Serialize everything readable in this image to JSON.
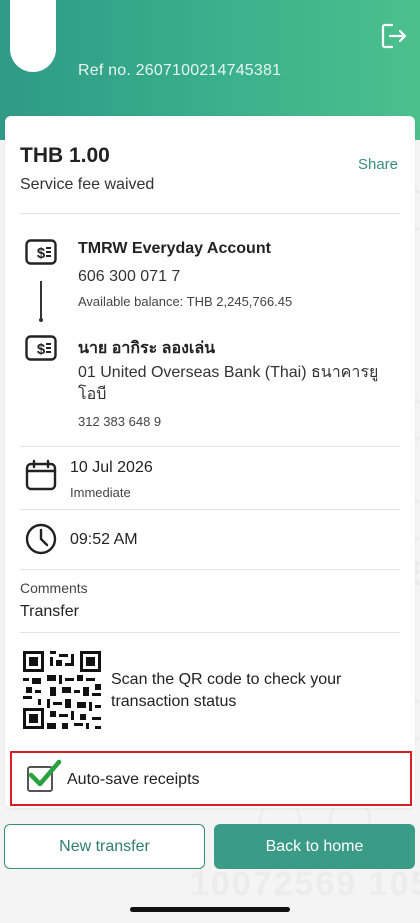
{
  "header": {
    "ref_label": "Ref no. 2607100214745381",
    "accent_color": "#37ad8c"
  },
  "watermark": {
    "text": "10072569 105"
  },
  "transfer": {
    "amount": "THB 1.00",
    "fee_note": "Service fee waived",
    "share_label": "Share"
  },
  "from_account": {
    "name": "TMRW Everyday Account",
    "number": "606 300 071 7",
    "balance": "Available balance: THB 2,245,766.45",
    "icon": "wallet-icon"
  },
  "to_account": {
    "name": "นาย อากิระ ลองเล่น",
    "bank": "01 United Overseas Bank (Thai) ธนาคารยูโอบี",
    "number": "312 383 648 9",
    "icon": "wallet-icon"
  },
  "schedule": {
    "date": "10 Jul 2026",
    "timing": "Immediate",
    "time": "09:52 AM"
  },
  "comments": {
    "label": "Comments",
    "value": "Transfer"
  },
  "qr": {
    "text": "Scan the QR code to check your transaction status"
  },
  "autosave": {
    "label": "Auto-save receipts",
    "checked": true,
    "highlight_color": "#d42027"
  },
  "buttons": {
    "new_transfer": "New transfer",
    "back_home": "Back to home"
  }
}
